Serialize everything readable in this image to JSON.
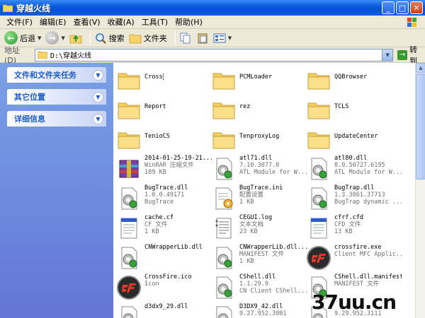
{
  "window": {
    "title": "穿越火线"
  },
  "menu": [
    "文件(F)",
    "编辑(E)",
    "查看(V)",
    "收藏(A)",
    "工具(T)",
    "帮助(H)"
  ],
  "toolbar": {
    "back_label": "后退",
    "search_label": "搜索",
    "folders_label": "文件夹"
  },
  "address": {
    "label": "地址(D)",
    "path": "D:\\穿越火线",
    "go_label": "转到"
  },
  "tasks": [
    {
      "label": "文件和文件夹任务"
    },
    {
      "label": "其它位置"
    },
    {
      "label": "详细信息"
    }
  ],
  "files": [
    {
      "kind": "folder",
      "name": "Cross",
      "l2": "",
      "l3": ""
    },
    {
      "kind": "folder",
      "name": "PCMLoader",
      "l2": "",
      "l3": ""
    },
    {
      "kind": "folder",
      "name": "QQBrowser",
      "l2": "",
      "l3": ""
    },
    {
      "kind": "folder",
      "name": "Report",
      "l2": "",
      "l3": ""
    },
    {
      "kind": "folder",
      "name": "rez",
      "l2": "",
      "l3": ""
    },
    {
      "kind": "folder",
      "name": "TCLS",
      "l2": "",
      "l3": ""
    },
    {
      "kind": "folder",
      "name": "TenioCS",
      "l2": "",
      "l3": ""
    },
    {
      "kind": "folder",
      "name": "TenproxyLog",
      "l2": "",
      "l3": ""
    },
    {
      "kind": "folder",
      "name": "UpdateCenter",
      "l2": "",
      "l3": ""
    },
    {
      "kind": "rar",
      "name": "2014-01-25-19-21...",
      "l2": "WinRAR 压缩文件",
      "l3": "189 KB"
    },
    {
      "kind": "dll",
      "name": "atl71.dll",
      "l2": "7.10.3077.0",
      "l3": "ATL Module for W..."
    },
    {
      "kind": "dll",
      "name": "atl80.dll",
      "l2": "8.0.50727.6195",
      "l3": "ATL Module for W..."
    },
    {
      "kind": "dll",
      "name": "BugTrace.dll",
      "l2": "1.0.0.49171",
      "l3": "BugTrace"
    },
    {
      "kind": "ini",
      "name": "BugTrace.ini",
      "l2": "配置设置",
      "l3": "1 KB"
    },
    {
      "kind": "dll",
      "name": "BugTrap.dll",
      "l2": "1.3.3861.37713",
      "l3": "BugTrap dynamic ..."
    },
    {
      "kind": "cf",
      "name": "cache.cf",
      "l2": "CF 文件",
      "l3": "1 KB"
    },
    {
      "kind": "log",
      "name": "CEGUI.log",
      "l2": "文本文档",
      "l3": "23 KB"
    },
    {
      "kind": "cf",
      "name": "cfrf.cfd",
      "l2": "CFD 文件",
      "l3": "13 KB"
    },
    {
      "kind": "dll",
      "name": "CNWrapperLib.dll",
      "l2": "",
      "l3": ""
    },
    {
      "kind": "dll",
      "name": "CNWrapperLib.dll...",
      "l2": "MANIFEST 文件",
      "l3": "1 KB"
    },
    {
      "kind": "cfexe",
      "name": "crossfire.exe",
      "l2": "Client MFC Applic...",
      "l3": ""
    },
    {
      "kind": "cfexe",
      "name": "CrossFire.ico",
      "l2": "Icon",
      "l3": ""
    },
    {
      "kind": "dll",
      "name": "CShell.dll",
      "l2": "1.1.29.9",
      "l3": "CN Client CShell..."
    },
    {
      "kind": "dll",
      "name": "CShell.dll.manifest",
      "l2": "MANIFEST 文件",
      "l3": ""
    },
    {
      "kind": "dll",
      "name": "d3dx9_29.dll",
      "l2": "",
      "l3": ""
    },
    {
      "kind": "dll",
      "name": "D3DX9_42.dll",
      "l2": "9.27.952.3001",
      "l3": ""
    },
    {
      "kind": "dll",
      "name": "",
      "l2": "9.29.952.3111",
      "l3": ""
    }
  ],
  "watermark": "37uu.cn",
  "colors": {
    "title_bar": "#0a5ce0",
    "task_pane": "#6b8ad9",
    "task_header_text": "#215dc6"
  }
}
